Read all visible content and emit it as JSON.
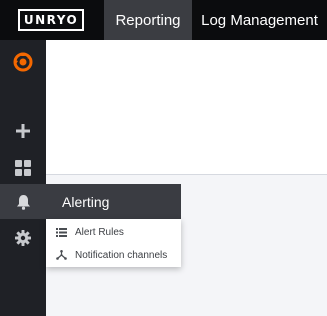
{
  "header": {
    "logo": "UNRYO",
    "tabs": [
      {
        "label": "Reporting",
        "active": true
      },
      {
        "label": "Log Management",
        "active": false
      }
    ]
  },
  "sidebar": {
    "items": [
      {
        "icon": "grafana-logo-icon"
      },
      {
        "icon": "plus-icon"
      },
      {
        "icon": "dashboards-grid-icon"
      },
      {
        "icon": "bell-icon",
        "active": true
      },
      {
        "icon": "gear-icon"
      }
    ]
  },
  "alerting_menu": {
    "title": "Alerting",
    "items": [
      {
        "label": "Alert Rules",
        "icon": "list-icon"
      },
      {
        "label": "Notification channels",
        "icon": "share-nodes-icon"
      }
    ]
  },
  "colors": {
    "topbar": "#0b0c0e",
    "sidebar": "#1f2126",
    "active": "#3a3c42",
    "accent": "#f46800"
  }
}
